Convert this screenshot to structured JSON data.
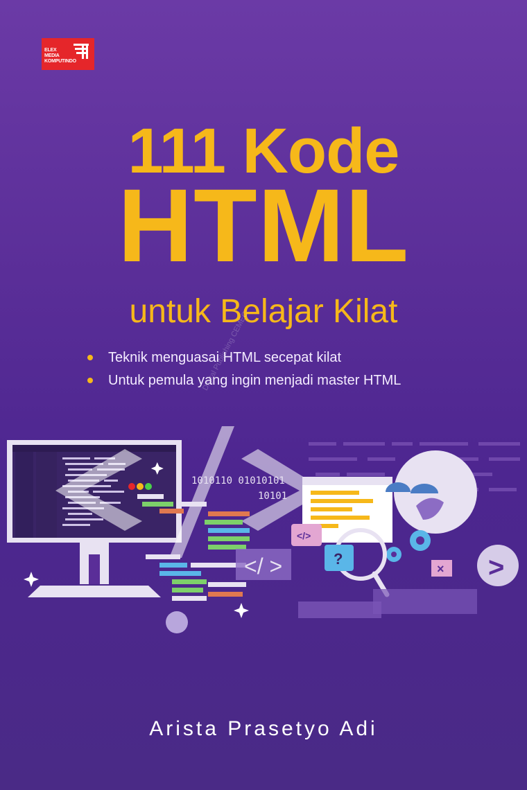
{
  "publisher": {
    "logo_text_lines": [
      "ELEX",
      "MEDIA",
      "KOMPUTINDO"
    ]
  },
  "title": {
    "line1": "111 Kode",
    "line2": "HTML",
    "subtitle": "untuk Belajar Kilat"
  },
  "bullets": [
    "Teknik menguasai HTML secepat kilat",
    "Untuk pemula yang ingin menjadi master HTML"
  ],
  "illustration": {
    "binary_line1": "1010110 01010101",
    "binary_line2": "10101",
    "code_tag_small": "</>",
    "code_tag_mid": "</ >",
    "question_mark": "?",
    "close_mark": "×",
    "arrow_mark": ">"
  },
  "watermark": "Digital Publishing CEMEC",
  "author": "Arista Prasetyo Adi",
  "colors": {
    "background": "#5a2e98",
    "title": "#f6b81a",
    "publisher_red": "#e5262a"
  }
}
